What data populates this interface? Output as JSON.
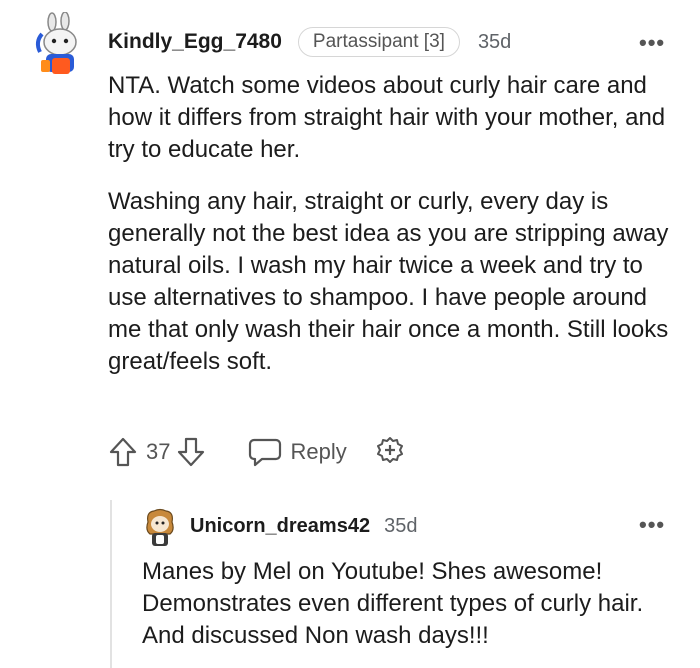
{
  "comment": {
    "username": "Kindly_Egg_7480",
    "flair": "Partassipant [3]",
    "time": "35d",
    "paragraphs": [
      "NTA. Watch some videos about curly hair care and how it differs from straight hair with your mother, and try to educate her.",
      "Washing any hair, straight or curly, every day is generally not the best idea as you are stripping away natural oils. I wash my hair twice a week and try to use alternatives to shampoo. I have people around me that only wash their hair once a month. Still looks great/feels soft."
    ],
    "votes": "37",
    "reply_label": "Reply",
    "more_label": "•••"
  },
  "reply": {
    "username": "Unicorn_dreams42",
    "time": "35d",
    "text": "Manes by Mel on Youtube! Shes awesome! Demonstrates even different types of curly hair. And discussed Non wash days!!!",
    "more_label": "•••"
  },
  "colors": {
    "text": "#1c1c1c",
    "muted": "#555555",
    "border": "#d6d6d6",
    "thread": "#e2e2e2",
    "avatar_blue": "#2a5bd7",
    "avatar_orange": "#ff5a1f"
  },
  "icons": [
    "snoo-avatar-icon",
    "upvote-icon",
    "downvote-icon",
    "reply-icon",
    "award-icon",
    "more-options-icon"
  ]
}
